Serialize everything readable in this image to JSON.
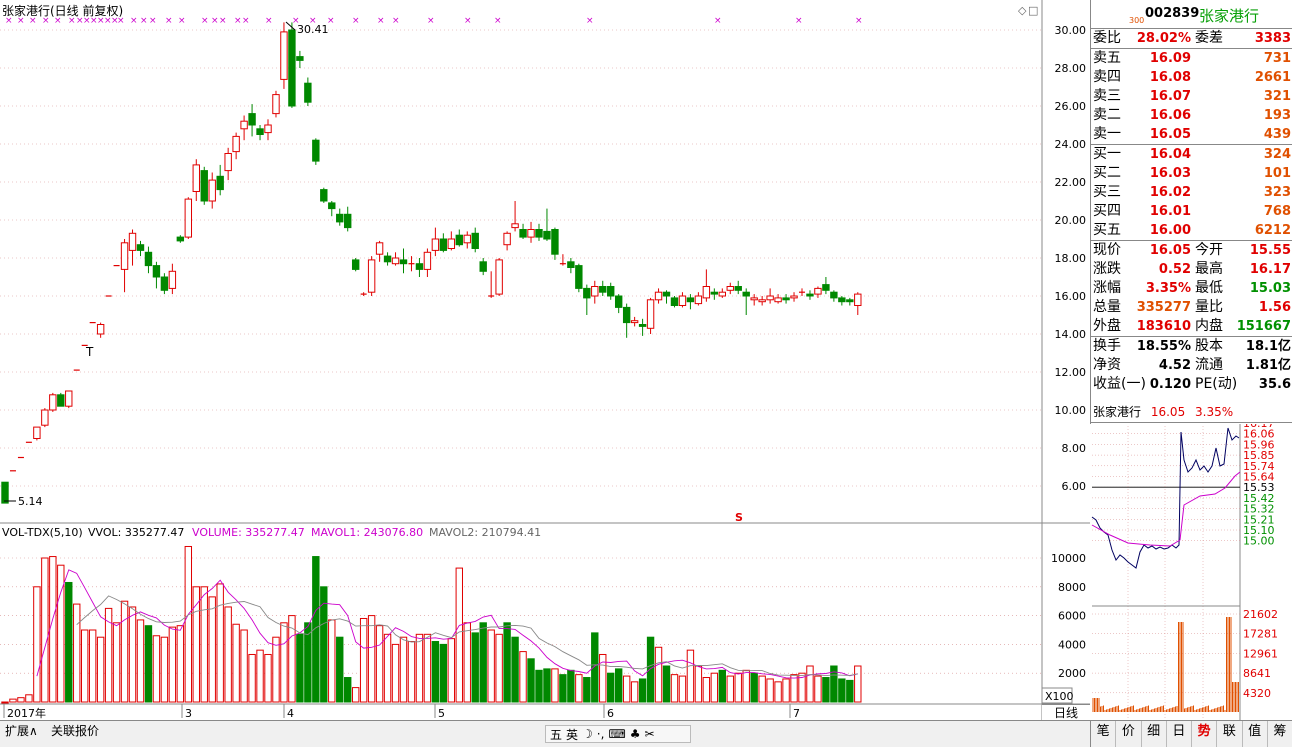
{
  "chart": {
    "title": "张家港行(日线 前复权)",
    "high_marker": "30.41",
    "low_marker": "5.14",
    "t_marker": "T",
    "s_marker": "S",
    "price_ticks": [
      "30.00",
      "28.00",
      "26.00",
      "24.00",
      "22.00",
      "20.00",
      "18.00",
      "16.00",
      "14.00",
      "12.00",
      "10.00",
      "8.00",
      "6.00"
    ],
    "vol_ticks": [
      "10000",
      "8000",
      "6000",
      "4000",
      "2000"
    ],
    "vol_unit": "X100",
    "date_labels": [
      "2017年",
      "3",
      "4",
      "5",
      "6",
      "7"
    ],
    "period": "日线"
  },
  "vol_header": {
    "name": "VOL-TDX(5,10)",
    "vvol": "VVOL: 335277.47",
    "volume": "VOLUME: 335277.47",
    "mavol1": "MAVOL1: 243076.80",
    "mavol2": "MAVOL2: 210794.41"
  },
  "chart_data": {
    "type": "candlestick",
    "ylim": [
      4.5,
      31
    ],
    "candles": [
      [
        6.2,
        5.1,
        6.2,
        5.1
      ],
      [
        6.8,
        6.8,
        6.8,
        6.8
      ],
      [
        7.5,
        7.5,
        7.5,
        7.5
      ],
      [
        8.3,
        8.3,
        8.3,
        8.3
      ],
      [
        8.5,
        9.1,
        8.4,
        9.1
      ],
      [
        9.2,
        10.0,
        9.1,
        10.1
      ],
      [
        10.0,
        10.8,
        9.9,
        10.9
      ],
      [
        10.8,
        10.2,
        10.9,
        10.2
      ],
      [
        10.2,
        11.0,
        10.1,
        11.0
      ],
      [
        12.1,
        12.1,
        12.1,
        12.1
      ],
      [
        13.4,
        13.4,
        13.4,
        13.4
      ],
      [
        14.6,
        14.6,
        14.6,
        14.6
      ],
      [
        14.0,
        14.5,
        13.8,
        14.6
      ],
      [
        16.0,
        16.0,
        16.0,
        16.0
      ],
      [
        17.6,
        17.6,
        17.6,
        17.6
      ],
      [
        17.4,
        18.8,
        16.2,
        19.0
      ],
      [
        18.4,
        19.3,
        17.6,
        19.5
      ],
      [
        18.7,
        18.4,
        18.1,
        18.9
      ],
      [
        18.3,
        17.6,
        17.2,
        18.6
      ],
      [
        17.6,
        17.0,
        16.4,
        17.8
      ],
      [
        17.0,
        16.3,
        16.1,
        17.2
      ],
      [
        16.4,
        17.3,
        16.1,
        17.7
      ],
      [
        19.1,
        18.9,
        18.8,
        19.2
      ],
      [
        19.1,
        21.1,
        19.0,
        21.2
      ],
      [
        21.5,
        22.9,
        21.0,
        23.2
      ],
      [
        22.6,
        21.0,
        20.8,
        22.8
      ],
      [
        21.0,
        22.1,
        20.6,
        22.5
      ],
      [
        22.3,
        21.6,
        21.3,
        22.9
      ],
      [
        22.6,
        23.5,
        22.1,
        23.8
      ],
      [
        23.6,
        24.4,
        23.2,
        24.6
      ],
      [
        24.8,
        25.2,
        24.2,
        25.5
      ],
      [
        25.6,
        25.0,
        24.4,
        26.1
      ],
      [
        24.8,
        24.5,
        24.2,
        25.0
      ],
      [
        24.6,
        25.0,
        24.2,
        25.3
      ],
      [
        25.6,
        26.6,
        25.4,
        26.8
      ],
      [
        27.4,
        29.9,
        26.9,
        30.4
      ],
      [
        30.0,
        26.0,
        25.9,
        30.4
      ],
      [
        28.6,
        28.4,
        28.0,
        28.9
      ],
      [
        27.2,
        26.2,
        26.0,
        27.5
      ],
      [
        24.2,
        23.1,
        22.9,
        24.3
      ],
      [
        21.6,
        21.0,
        20.9,
        21.7
      ],
      [
        20.9,
        20.6,
        20.2,
        21.0
      ],
      [
        20.3,
        19.9,
        19.7,
        20.6
      ],
      [
        20.3,
        19.6,
        19.4,
        20.7
      ],
      [
        17.9,
        17.4,
        17.3,
        18.0
      ],
      [
        16.1,
        16.1,
        16.0,
        16.2
      ],
      [
        16.2,
        17.9,
        16.0,
        18.1
      ],
      [
        18.2,
        18.8,
        17.8,
        18.9
      ],
      [
        18.1,
        17.8,
        17.6,
        18.3
      ],
      [
        17.7,
        18.0,
        17.6,
        18.3
      ],
      [
        17.9,
        17.7,
        17.2,
        18.5
      ],
      [
        17.7,
        17.7,
        17.3,
        18.1
      ],
      [
        17.7,
        17.4,
        17.0,
        18.0
      ],
      [
        17.4,
        18.3,
        17.0,
        18.5
      ],
      [
        18.4,
        19.0,
        18.1,
        19.6
      ],
      [
        19.0,
        18.4,
        18.3,
        19.3
      ],
      [
        18.5,
        19.0,
        18.4,
        19.4
      ],
      [
        19.2,
        18.7,
        18.6,
        19.5
      ],
      [
        18.8,
        19.2,
        18.5,
        19.4
      ],
      [
        19.3,
        18.5,
        18.3,
        19.6
      ],
      [
        17.8,
        17.3,
        17.1,
        18.0
      ],
      [
        16.0,
        16.0,
        15.9,
        17.3
      ],
      [
        16.1,
        17.9,
        16.0,
        18.0
      ],
      [
        18.7,
        19.3,
        18.4,
        19.4
      ],
      [
        19.6,
        19.8,
        19.4,
        21.0
      ],
      [
        19.5,
        19.1,
        19.0,
        19.8
      ],
      [
        19.1,
        19.5,
        18.8,
        19.9
      ],
      [
        19.5,
        19.1,
        18.9,
        19.8
      ],
      [
        19.4,
        19.0,
        18.9,
        20.6
      ],
      [
        19.5,
        18.2,
        17.9,
        19.6
      ],
      [
        17.7,
        17.7,
        17.6,
        18.2
      ],
      [
        17.8,
        17.5,
        17.2,
        18.0
      ],
      [
        17.6,
        16.4,
        16.2,
        17.7
      ],
      [
        16.4,
        15.9,
        15.0,
        16.6
      ],
      [
        16.0,
        16.5,
        15.6,
        16.8
      ],
      [
        16.5,
        16.2,
        16.0,
        16.8
      ],
      [
        16.5,
        16.0,
        15.8,
        16.7
      ],
      [
        16.0,
        15.4,
        15.1,
        16.1
      ],
      [
        15.4,
        14.6,
        13.8,
        15.6
      ],
      [
        14.6,
        14.7,
        14.4,
        14.9
      ],
      [
        14.5,
        14.4,
        13.9,
        14.8
      ],
      [
        14.3,
        15.8,
        14.0,
        15.9
      ],
      [
        15.8,
        16.2,
        15.6,
        16.4
      ],
      [
        16.2,
        16.0,
        15.6,
        16.3
      ],
      [
        15.9,
        15.5,
        15.4,
        16.0
      ],
      [
        15.5,
        16.0,
        15.4,
        16.2
      ],
      [
        15.9,
        15.7,
        15.3,
        16.1
      ],
      [
        15.6,
        16.0,
        15.5,
        16.2
      ],
      [
        15.9,
        16.5,
        15.7,
        17.4
      ],
      [
        16.2,
        16.1,
        15.8,
        16.4
      ],
      [
        16.0,
        16.2,
        15.9,
        16.4
      ],
      [
        16.3,
        16.5,
        16.1,
        16.7
      ],
      [
        16.5,
        16.3,
        16.1,
        16.8
      ],
      [
        16.2,
        16.0,
        15.0,
        16.4
      ],
      [
        15.8,
        15.9,
        15.5,
        16.1
      ],
      [
        15.7,
        15.8,
        15.5,
        16.0
      ],
      [
        15.8,
        16.0,
        15.6,
        16.4
      ],
      [
        15.7,
        15.9,
        15.6,
        16.1
      ],
      [
        15.9,
        15.8,
        15.6,
        16.1
      ],
      [
        15.9,
        16.0,
        15.7,
        16.2
      ],
      [
        16.2,
        16.2,
        16.0,
        16.4
      ],
      [
        16.1,
        16.0,
        15.8,
        16.3
      ],
      [
        16.1,
        16.4,
        15.9,
        16.5
      ],
      [
        16.6,
        16.3,
        16.1,
        17.0
      ],
      [
        16.2,
        15.9,
        15.7,
        16.3
      ],
      [
        15.9,
        15.7,
        15.5,
        16.0
      ],
      [
        15.8,
        15.7,
        15.5,
        15.9
      ],
      [
        15.5,
        16.1,
        15.0,
        16.2
      ]
    ],
    "volumes": [
      [
        0,
        1
      ],
      [
        2,
        1
      ],
      [
        3,
        1
      ],
      [
        5,
        1
      ],
      [
        80,
        1
      ],
      [
        100,
        1
      ],
      [
        101,
        1
      ],
      [
        95,
        1
      ],
      [
        83,
        0
      ],
      [
        68,
        1
      ],
      [
        50,
        1
      ],
      [
        50,
        1
      ],
      [
        45,
        1
      ],
      [
        65,
        1
      ],
      [
        55,
        1
      ],
      [
        70,
        1
      ],
      [
        66,
        1
      ],
      [
        57,
        1
      ],
      [
        53,
        0
      ],
      [
        46,
        1
      ],
      [
        45,
        1
      ],
      [
        52,
        1
      ],
      [
        53,
        1
      ],
      [
        108,
        1
      ],
      [
        80,
        1
      ],
      [
        80,
        1
      ],
      [
        73,
        1
      ],
      [
        82,
        1
      ],
      [
        66,
        1
      ],
      [
        54,
        1
      ],
      [
        50,
        1
      ],
      [
        33,
        1
      ],
      [
        36,
        1
      ],
      [
        33,
        1
      ],
      [
        45,
        1
      ],
      [
        55,
        1
      ],
      [
        60,
        1
      ],
      [
        47,
        0
      ],
      [
        55,
        0
      ],
      [
        101,
        0
      ],
      [
        80,
        0
      ],
      [
        57,
        1
      ],
      [
        45,
        0
      ],
      [
        17,
        0
      ],
      [
        10,
        1
      ],
      [
        58,
        1
      ],
      [
        60,
        1
      ],
      [
        53,
        1
      ],
      [
        47,
        1
      ],
      [
        40,
        1
      ],
      [
        45,
        1
      ],
      [
        42,
        1
      ],
      [
        47,
        1
      ],
      [
        47,
        1
      ],
      [
        42,
        0
      ],
      [
        40,
        0
      ],
      [
        44,
        1
      ],
      [
        93,
        1
      ],
      [
        55,
        1
      ],
      [
        48,
        0
      ],
      [
        55,
        0
      ],
      [
        50,
        1
      ],
      [
        47,
        1
      ],
      [
        55,
        0
      ],
      [
        45,
        0
      ],
      [
        35,
        1
      ],
      [
        30,
        0
      ],
      [
        22,
        0
      ],
      [
        23,
        0
      ],
      [
        23,
        1
      ],
      [
        19,
        0
      ],
      [
        22,
        0
      ],
      [
        19,
        1
      ],
      [
        17,
        0
      ],
      [
        48,
        0
      ],
      [
        33,
        1
      ],
      [
        20,
        0
      ],
      [
        23,
        0
      ],
      [
        18,
        1
      ],
      [
        14,
        1
      ],
      [
        16,
        0
      ],
      [
        45,
        0
      ],
      [
        38,
        1
      ],
      [
        25,
        0
      ],
      [
        19,
        1
      ],
      [
        18,
        1
      ],
      [
        36,
        1
      ],
      [
        25,
        1
      ],
      [
        17,
        1
      ],
      [
        20,
        1
      ],
      [
        22,
        0
      ],
      [
        18,
        1
      ],
      [
        20,
        1
      ],
      [
        22,
        1
      ],
      [
        20,
        0
      ],
      [
        18,
        1
      ],
      [
        16,
        1
      ],
      [
        14,
        1
      ],
      [
        16,
        1
      ],
      [
        19,
        1
      ],
      [
        20,
        1
      ],
      [
        25,
        1
      ],
      [
        18,
        1
      ],
      [
        17,
        0
      ],
      [
        25,
        0
      ],
      [
        16,
        0
      ],
      [
        15,
        0
      ],
      [
        25,
        1
      ]
    ]
  },
  "quote": {
    "code": "002839",
    "market": "300",
    "name": "张家港行",
    "weibi_label": "委比",
    "weibi": "28.02%",
    "weicha_label": "委差",
    "weicha": "3383",
    "asks": [
      {
        "label": "卖五",
        "price": "16.09",
        "vol": "731"
      },
      {
        "label": "卖四",
        "price": "16.08",
        "vol": "2661"
      },
      {
        "label": "卖三",
        "price": "16.07",
        "vol": "321"
      },
      {
        "label": "卖二",
        "price": "16.06",
        "vol": "193"
      },
      {
        "label": "卖一",
        "price": "16.05",
        "vol": "439"
      }
    ],
    "bids": [
      {
        "label": "买一",
        "price": "16.04",
        "vol": "324"
      },
      {
        "label": "买二",
        "price": "16.03",
        "vol": "101"
      },
      {
        "label": "买三",
        "price": "16.02",
        "vol": "323"
      },
      {
        "label": "买四",
        "price": "16.01",
        "vol": "768"
      },
      {
        "label": "买五",
        "price": "16.00",
        "vol": "6212"
      }
    ],
    "stats": [
      {
        "l1": "现价",
        "v1": "16.05",
        "c1": "red",
        "l2": "今开",
        "v2": "15.55",
        "c2": "red"
      },
      {
        "l1": "涨跌",
        "v1": "0.52",
        "c1": "red",
        "l2": "最高",
        "v2": "16.17",
        "c2": "red"
      },
      {
        "l1": "涨幅",
        "v1": "3.35%",
        "c1": "red",
        "l2": "最低",
        "v2": "15.03",
        "c2": "green"
      },
      {
        "l1": "总量",
        "v1": "335277",
        "c1": "orange",
        "l2": "量比",
        "v2": "1.56",
        "c2": "red"
      },
      {
        "l1": "外盘",
        "v1": "183610",
        "c1": "red",
        "l2": "内盘",
        "v2": "151667",
        "c2": "green"
      }
    ],
    "fund": [
      {
        "l1": "换手",
        "v1": "18.55%",
        "l2": "股本",
        "v2": "18.1亿"
      },
      {
        "l1": "净资",
        "v1": "4.52",
        "l2": "流通",
        "v2": "1.81亿"
      },
      {
        "l1": "收益(一)",
        "v1": "0.120",
        "l2": "PE(动)",
        "v2": "35.6"
      }
    ]
  },
  "mini": {
    "name": "张家港行",
    "price": "16.05",
    "pct": "3.35%",
    "price_ticks": [
      "16.17",
      "16.06",
      "15.96",
      "15.85",
      "15.74",
      "15.64",
      "15.53",
      "15.42",
      "15.32",
      "15.21",
      "15.10",
      "15.00"
    ],
    "vol_ticks": [
      "21602",
      "17281",
      "12961",
      "8641",
      "4320"
    ]
  },
  "status_bar": {
    "tab1": "扩展∧",
    "tab2": "关联报价",
    "ime_items": [
      "五",
      "英",
      "☽",
      "·,",
      "⌨",
      "♣",
      "✂"
    ]
  },
  "right_tabs": [
    "笔",
    "价",
    "细",
    "日",
    "势",
    "联",
    "值",
    "筹"
  ],
  "colors": {
    "up": "#e00000",
    "down": "#008800",
    "ma1": "#cc00cc",
    "ma2": "#888888",
    "grid": "#cc4444"
  }
}
